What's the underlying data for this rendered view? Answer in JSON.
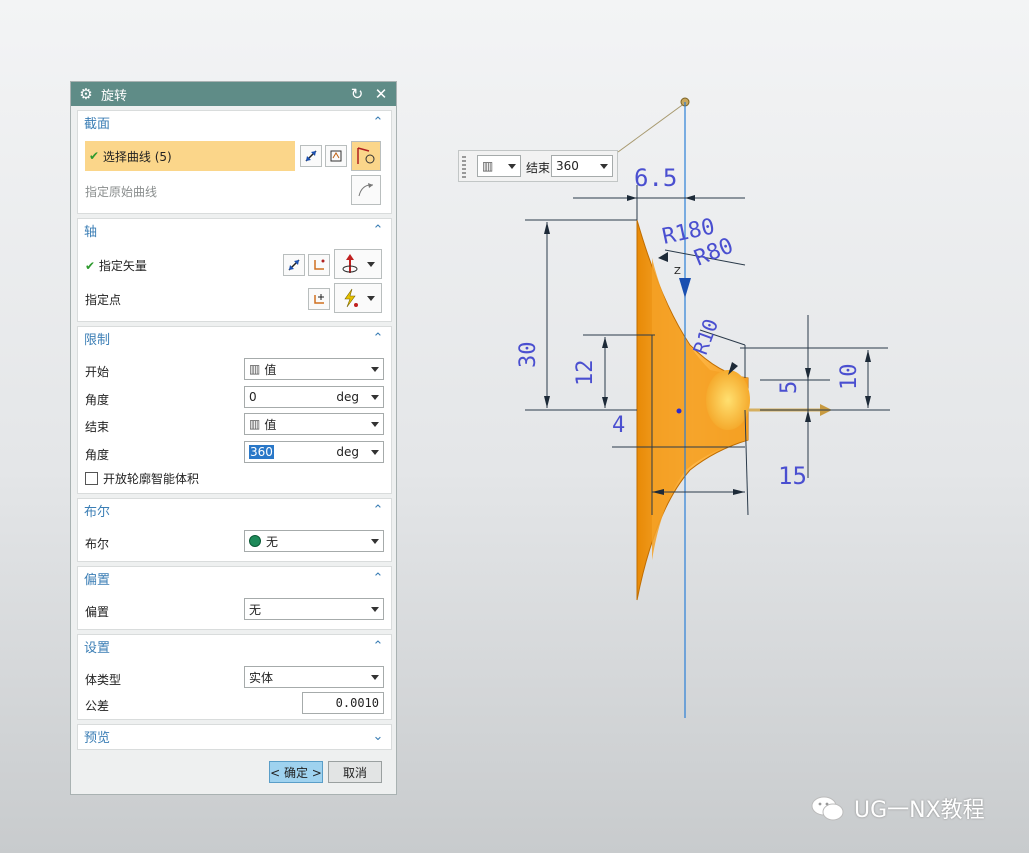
{
  "dialog": {
    "title": "旋转",
    "icons": {
      "settings": "gear-icon",
      "reset": "reset-icon",
      "close": "close-icon"
    },
    "section_profile": {
      "title": "截面",
      "select_curve": "选择曲线 (5)",
      "specify_original_curve": "指定原始曲线"
    },
    "section_axis": {
      "title": "轴",
      "specify_vector": "指定矢量",
      "specify_point": "指定点"
    },
    "section_limits": {
      "title": "限制",
      "start_label": "开始",
      "start_value": "值",
      "start_angle_label": "角度",
      "start_angle": "0",
      "start_unit": "deg",
      "end_label": "结束",
      "end_value": "值",
      "end_angle_label": "角度",
      "end_angle": "360",
      "end_unit": "deg",
      "open_profile": "开放轮廓智能体积"
    },
    "section_boolean": {
      "title": "布尔",
      "label": "布尔",
      "value": "无"
    },
    "section_offset": {
      "title": "偏置",
      "label": "偏置",
      "value": "无"
    },
    "section_settings": {
      "title": "设置",
      "body_type_label": "体类型",
      "body_type": "实体",
      "tolerance_label": "公差",
      "tolerance": "0.0010"
    },
    "section_preview": {
      "title": "预览"
    },
    "ok_button": "< 确定 >",
    "cancel_button": "取消"
  },
  "float_toolbar": {
    "label": "结束",
    "value": "360"
  },
  "drawing": {
    "dims": [
      "6.5",
      "R180",
      "R80",
      "R10",
      "30",
      "12",
      "4",
      "5",
      "10",
      "15"
    ],
    "axis_label": "Z",
    "body_color": "#f39a14",
    "axis_color": "#2b7fd6",
    "dim_color": "#4a4fd0"
  },
  "watermark": "UG一NX教程"
}
